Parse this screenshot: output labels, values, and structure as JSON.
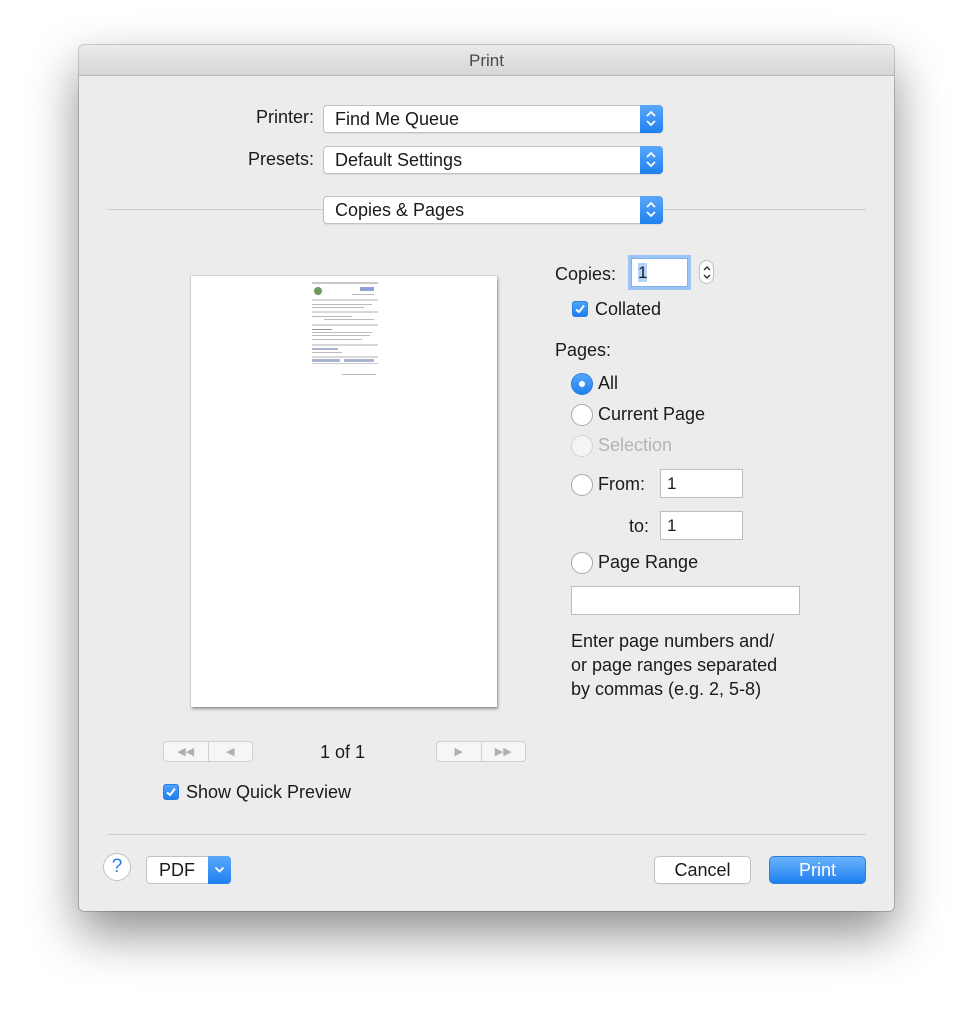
{
  "window": {
    "title": "Print"
  },
  "printer": {
    "label": "Printer:",
    "value": "Find Me Queue"
  },
  "presets": {
    "label": "Presets:",
    "value": "Default Settings"
  },
  "section": {
    "value": "Copies & Pages"
  },
  "preview": {
    "page_indicator": "1 of 1",
    "show_quick_preview": "Show Quick Preview"
  },
  "copies": {
    "label": "Copies:",
    "value": "1",
    "collated_label": "Collated"
  },
  "pages": {
    "label": "Pages:",
    "all": "All",
    "current_page": "Current Page",
    "selection": "Selection",
    "from_label": "From:",
    "from_value": "1",
    "to_label": "to:",
    "to_value": "1",
    "page_range": "Page Range",
    "page_range_value": "",
    "help_text_1": "Enter page numbers and/",
    "help_text_2": "or page ranges separated",
    "help_text_3": "by commas (e.g. 2, 5-8)"
  },
  "footer": {
    "help": "?",
    "pdf": "PDF",
    "cancel": "Cancel",
    "print": "Print"
  },
  "colors": {
    "accent": "#1f80ef",
    "window_bg": "#ececec"
  }
}
